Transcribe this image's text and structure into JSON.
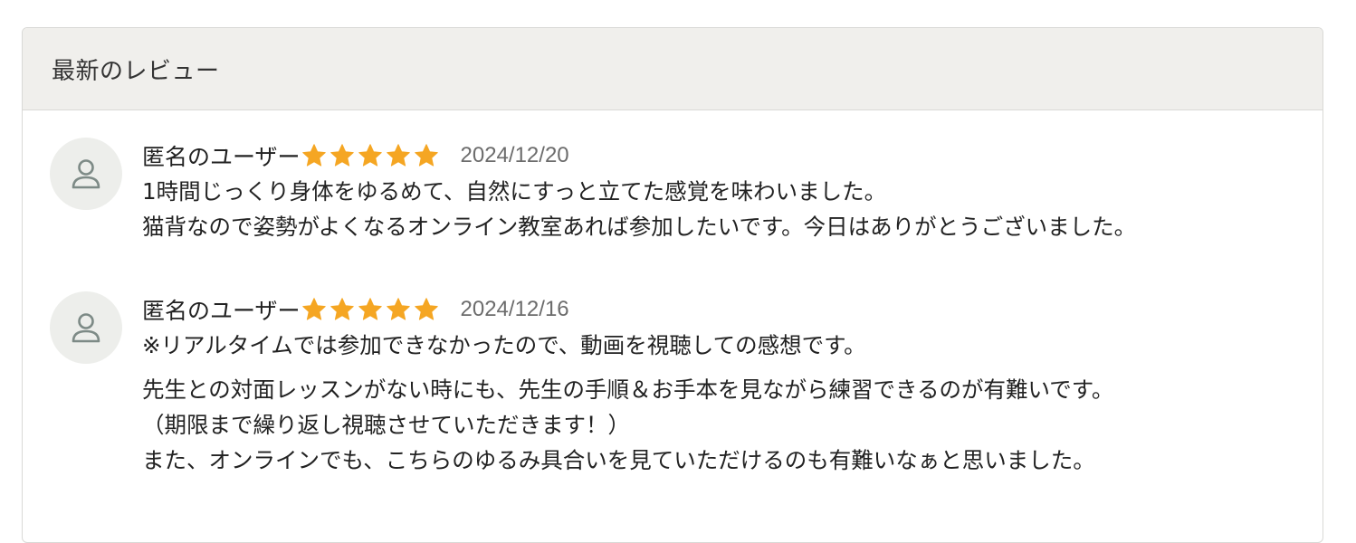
{
  "panel": {
    "title": "最新のレビュー"
  },
  "reviews": [
    {
      "reviewer": "匿名のユーザー",
      "rating": 5,
      "date": "2024/12/20",
      "paragraphs": [
        [
          "1時間じっくり身体をゆるめて、自然にすっと立てた感覚を味わいました。",
          "猫背なので姿勢がよくなるオンライン教室あれば参加したいです。今日はありがとうございました。"
        ]
      ]
    },
    {
      "reviewer": "匿名のユーザー",
      "rating": 5,
      "date": "2024/12/16",
      "paragraphs": [
        [
          "※リアルタイムでは参加できなかったので、動画を視聴しての感想です。"
        ],
        [
          "先生との対面レッスンがない時にも、先生の手順＆お手本を見ながら練習できるのが有難いです。",
          "（期限まで繰り返し視聴させていただきます！）",
          "また、オンラインでも、こちらのゆるみ具合いを見ていただけるのも有難いなぁと思いました。"
        ]
      ]
    }
  ],
  "colors": {
    "star": "#f5a623",
    "header_bg": "#f0efec",
    "avatar_bg": "#edeeeb",
    "avatar_icon": "#7d8a86",
    "date": "#6c6c6c"
  },
  "icons": {
    "avatar": "user-icon",
    "rating": "star-icon"
  }
}
